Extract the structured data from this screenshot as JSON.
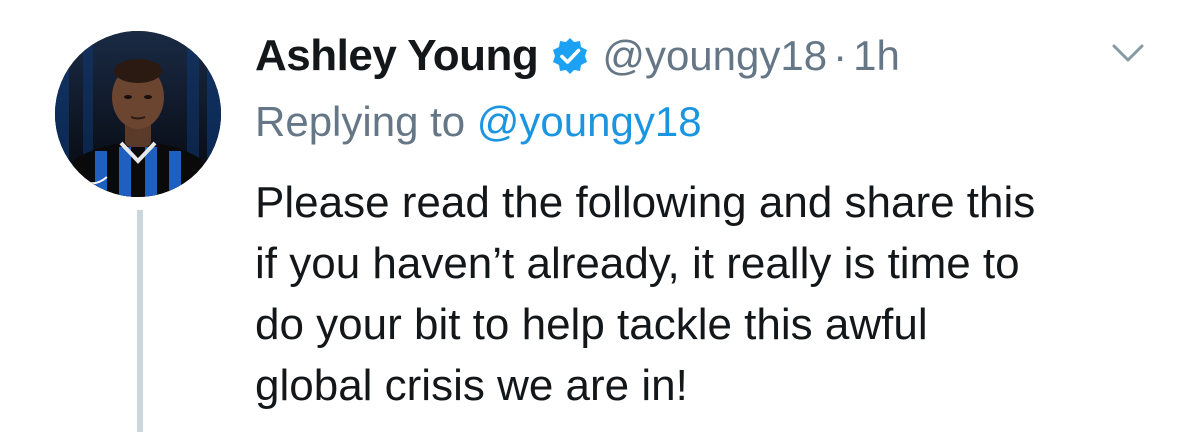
{
  "author": {
    "display_name": "Ashley Young",
    "handle": "@youngy18",
    "separator": "·",
    "time": "1h",
    "verified": true,
    "avatar_icon": "profile-photo-footballer"
  },
  "reply": {
    "prefix": "Replying to",
    "to_handle": "@youngy18"
  },
  "tweet": {
    "lines": [
      "Please read the following and share this",
      "if you haven’t already, it really is time to",
      "do your bit to help tackle this awful",
      "global crisis we are in!"
    ]
  },
  "icons": {
    "verified": "verified-badge-icon",
    "menu": "chevron-down-icon"
  },
  "colors": {
    "text": "#14171a",
    "secondary": "#657786",
    "link": "#1b95e0",
    "verified": "#1da1f2",
    "thread_line": "#ccd6dd"
  }
}
